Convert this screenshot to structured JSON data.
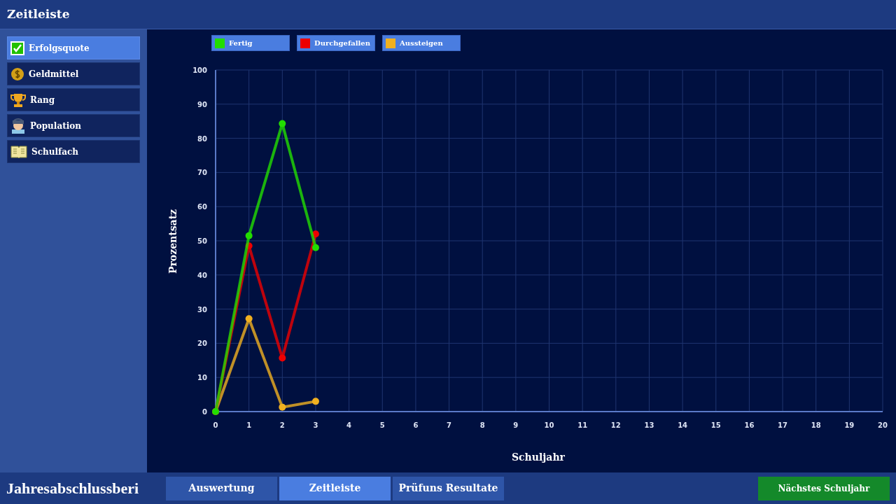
{
  "header": {
    "title": "Zeitleiste"
  },
  "sidebar": {
    "items": [
      {
        "label": "Erfolgsquote",
        "selected": true
      },
      {
        "label": "Geldmittel",
        "selected": false
      },
      {
        "label": "Rang",
        "selected": false
      },
      {
        "label": "Population",
        "selected": false
      },
      {
        "label": "Schulfach",
        "selected": false
      }
    ]
  },
  "chart": {
    "chart_data": {
      "type": "line",
      "grid": true,
      "xlabel": "Schuljahr",
      "ylabel": "Prozentsatz",
      "x": [
        0,
        1,
        2,
        3
      ],
      "series": [
        {
          "name": "Fertig",
          "color": "#22dd00",
          "marker": true,
          "values": [
            0,
            51.5,
            84.3,
            48
          ]
        },
        {
          "name": "Durchgefallen",
          "color": "#ee0000",
          "marker": true,
          "values": [
            0,
            48.5,
            15.7,
            52
          ]
        },
        {
          "name": "Aussteigen",
          "color": "#f0b020",
          "marker": true,
          "values": [
            0,
            27.2,
            1.3,
            3
          ]
        }
      ],
      "xlim": [
        0,
        20
      ],
      "ylim": [
        0,
        100
      ],
      "xticks": [
        0,
        1,
        2,
        3,
        4,
        5,
        6,
        7,
        8,
        9,
        10,
        11,
        12,
        13,
        14,
        15,
        16,
        17,
        18,
        19,
        20
      ],
      "yticks": [
        0,
        10,
        20,
        30,
        40,
        50,
        60,
        70,
        80,
        90,
        100
      ]
    }
  },
  "footer": {
    "title": "Jahresabschlussberi",
    "tabs": [
      {
        "label": "Auswertung",
        "selected": false
      },
      {
        "label": "Zeitleiste",
        "selected": true
      },
      {
        "label": "Prüfuns Resultate",
        "selected": false
      }
    ],
    "next_button": "Nächstes Schuljahr"
  }
}
